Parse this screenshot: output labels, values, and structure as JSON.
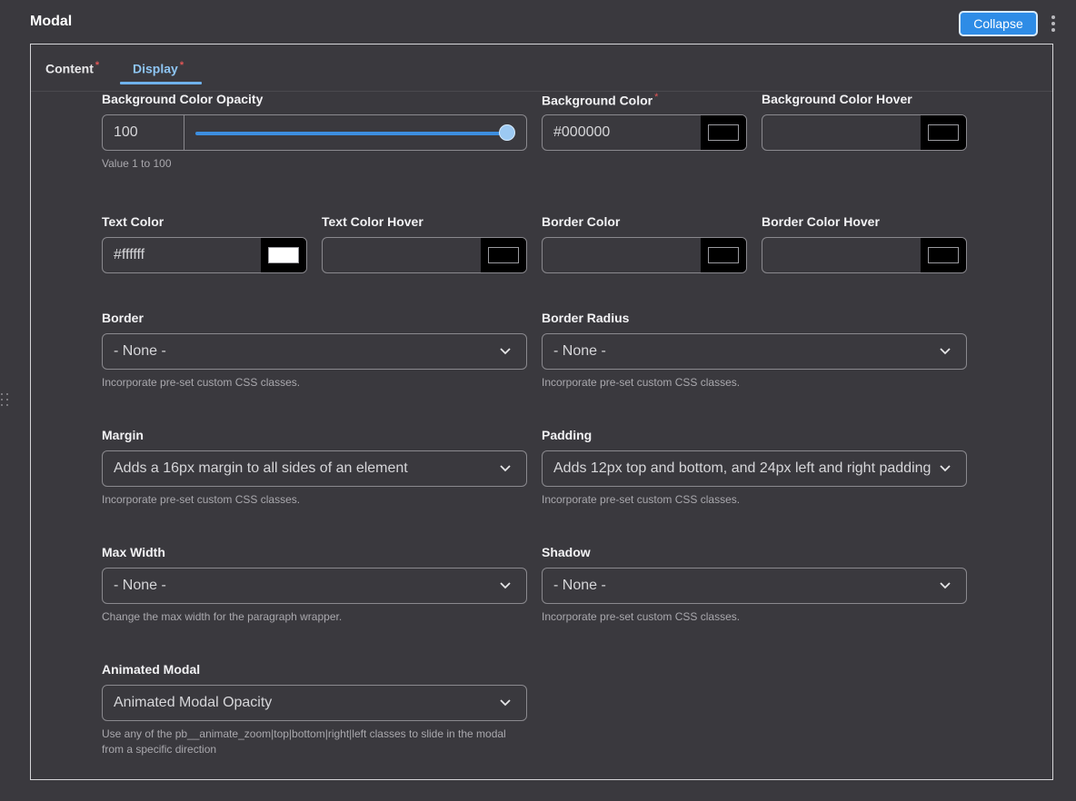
{
  "header": {
    "title": "Modal",
    "collapse_label": "Collapse"
  },
  "tabs": [
    {
      "label": "Content",
      "required": "*"
    },
    {
      "label": "Display",
      "required": "*",
      "active": true
    }
  ],
  "fields": {
    "bg_opacity": {
      "label": "Background Color Opacity",
      "value": "100",
      "slider_fraction": 1.0,
      "help": "Value 1 to 100"
    },
    "bg_color": {
      "label": "Background Color",
      "required": "*",
      "value": "#000000",
      "swatch": "#000000"
    },
    "bg_color_hover": {
      "label": "Background Color Hover",
      "value": "",
      "swatch": "#000000"
    },
    "text_color": {
      "label": "Text Color",
      "value": "#ffffff",
      "swatch": "#ffffff"
    },
    "text_color_hover": {
      "label": "Text Color Hover",
      "value": "",
      "swatch": "#000000"
    },
    "border_color": {
      "label": "Border Color",
      "value": "",
      "swatch": "#000000"
    },
    "border_color_hover": {
      "label": "Border Color Hover",
      "value": "",
      "swatch": "#000000"
    },
    "border": {
      "label": "Border",
      "value": "- None -",
      "help": "Incorporate pre-set custom CSS classes."
    },
    "border_radius": {
      "label": "Border Radius",
      "value": "- None -",
      "help": "Incorporate pre-set custom CSS classes."
    },
    "margin": {
      "label": "Margin",
      "value": "Adds a 16px margin to all sides of an element",
      "help": "Incorporate pre-set custom CSS classes."
    },
    "padding": {
      "label": "Padding",
      "value": "Adds 12px top and bottom, and 24px left and right padding",
      "help": "Incorporate pre-set custom CSS classes."
    },
    "max_width": {
      "label": "Max Width",
      "value": "- None -",
      "help": "Change the max width for the paragraph wrapper."
    },
    "shadow": {
      "label": "Shadow",
      "value": "- None -",
      "help": "Incorporate pre-set custom CSS classes."
    },
    "animated_modal": {
      "label": "Animated Modal",
      "value": "Animated Modal Opacity",
      "help": "Use any of the pb__animate_zoom|top|bottom|right|left classes to slide in the modal from a specific direction"
    }
  }
}
